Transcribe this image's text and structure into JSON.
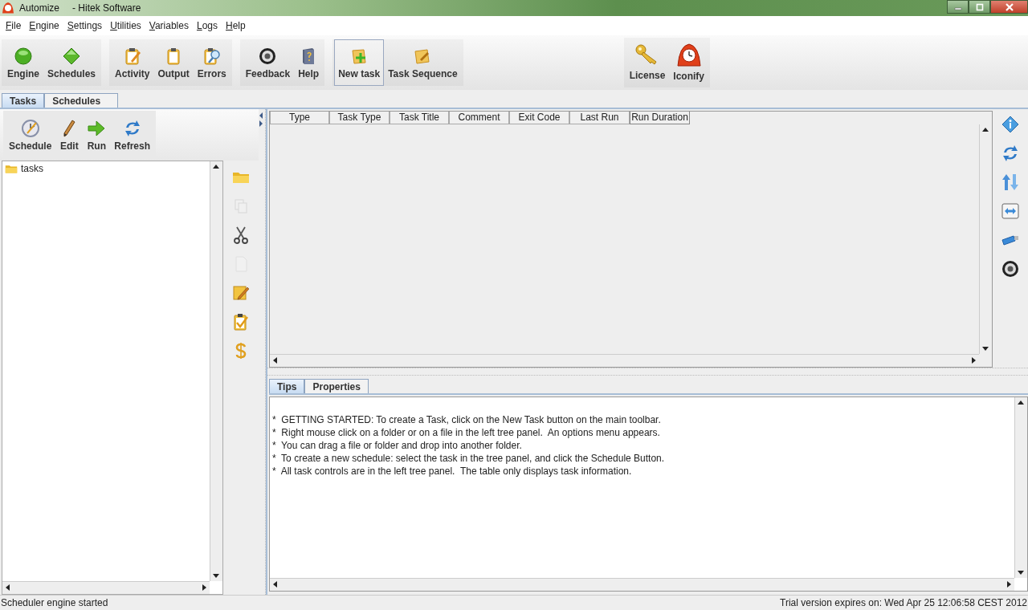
{
  "window": {
    "title": "Automize",
    "subtitle": "- Hitek Software"
  },
  "menu": [
    "File",
    "Engine",
    "Settings",
    "Utilities",
    "Variables",
    "Logs",
    "Help"
  ],
  "toolbar": {
    "groups": [
      {
        "buttons": [
          {
            "label": "Engine",
            "selected": false
          },
          {
            "label": "Schedules",
            "selected": false
          }
        ]
      },
      {
        "buttons": [
          {
            "label": "Activity",
            "selected": false
          },
          {
            "label": "Output",
            "selected": false
          },
          {
            "label": "Errors",
            "selected": false
          }
        ]
      },
      {
        "buttons": [
          {
            "label": "Feedback",
            "selected": false
          },
          {
            "label": "Help",
            "selected": false
          }
        ]
      },
      {
        "buttons": [
          {
            "label": "New task",
            "selected": true
          },
          {
            "label": "Task Sequence",
            "selected": false
          }
        ]
      }
    ],
    "extra_buttons": [
      {
        "label": "License",
        "selected": false
      },
      {
        "label": "Iconify",
        "selected": false
      }
    ]
  },
  "left_tabs": [
    {
      "label": "Tasks",
      "selected": true
    },
    {
      "label": "Schedules",
      "selected": false
    }
  ],
  "task_toolbar": [
    "Schedule",
    "Edit",
    "Run",
    "Refresh"
  ],
  "tree": [
    {
      "label": "tasks"
    }
  ],
  "tree_tools": [
    {
      "disabled": false
    },
    {
      "disabled": true
    },
    {
      "disabled": false
    },
    {
      "disabled": true
    },
    {
      "disabled": false
    },
    {
      "disabled": false
    },
    {
      "disabled": false
    }
  ],
  "table": {
    "columns": [
      "Type",
      "Task Type",
      "Task Title",
      "Comment",
      "Exit Code",
      "Last Run",
      "Run Duration"
    ]
  },
  "bottom_tabs": [
    {
      "label": "Tips",
      "selected": true
    },
    {
      "label": "Properties",
      "selected": false
    }
  ],
  "tips": [
    "*  GETTING STARTED: To create a Task, click on the New Task button on the main toolbar.",
    "*  Right mouse click on a folder or on a file in the left tree panel.  An options menu appears.",
    "*  You can drag a file or folder and drop into another folder.",
    "*  To create a new schedule: select the task in the tree panel, and click the Schedule Button.",
    "*  All task controls are in the left tree panel.  The table only displays task information."
  ],
  "status_bar": {
    "left": "Scheduler engine started",
    "right": "Trial version expires on: Wed Apr 25 12:06:58 CEST 2012"
  }
}
